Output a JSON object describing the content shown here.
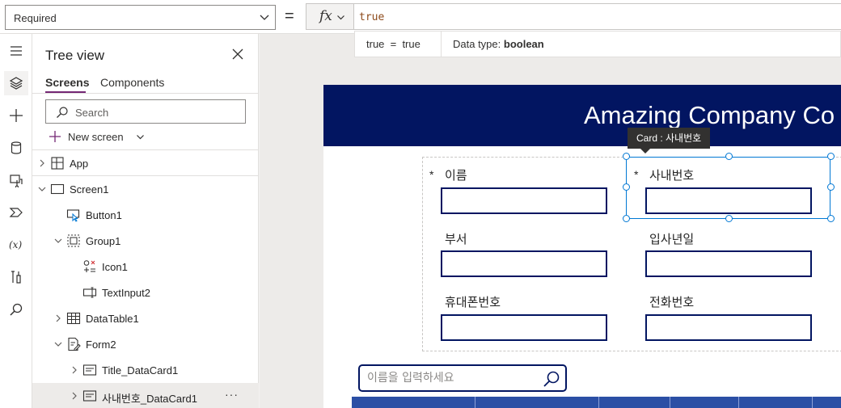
{
  "formula_bar": {
    "property": "Required",
    "equals": "=",
    "fx": "fx",
    "formula": "true",
    "eval_expression": "true  =  true",
    "data_type_label": "Data type:",
    "data_type_value": "boolean"
  },
  "rail": {
    "icons": [
      "hamburger-icon",
      "layers-icon",
      "plus-icon",
      "database-icon",
      "media-icon",
      "power-automate-icon",
      "variables-icon",
      "tools-icon",
      "search-icon"
    ]
  },
  "tree": {
    "title": "Tree view",
    "tabs": [
      "Screens",
      "Components"
    ],
    "search_placeholder": "Search",
    "new_screen": "New screen",
    "items": [
      {
        "label": "App"
      },
      {
        "label": "Screen1"
      },
      {
        "label": "Button1"
      },
      {
        "label": "Group1"
      },
      {
        "label": "Icon1"
      },
      {
        "label": "TextInput2"
      },
      {
        "label": "DataTable1"
      },
      {
        "label": "Form2"
      },
      {
        "label": "Title_DataCard1"
      },
      {
        "label": "사내번호_DataCard1"
      }
    ],
    "more": "···"
  },
  "canvas": {
    "header_title": "Amazing Company Co",
    "tooltip": "Card : 사내번호",
    "fields": [
      {
        "label": "이름",
        "required": true,
        "req_mark": "*"
      },
      {
        "label": "사내번호",
        "required": true,
        "req_mark": "*"
      },
      {
        "label": "부서",
        "required": false
      },
      {
        "label": "입사년일",
        "required": false
      },
      {
        "label": "휴대폰번호",
        "required": false
      },
      {
        "label": "전화번호",
        "required": false
      }
    ],
    "name_search_placeholder": "이름을 입력하세요"
  },
  "colors": {
    "header_bg": "#021561",
    "accent": "#742774",
    "selection": "#0078d4"
  }
}
